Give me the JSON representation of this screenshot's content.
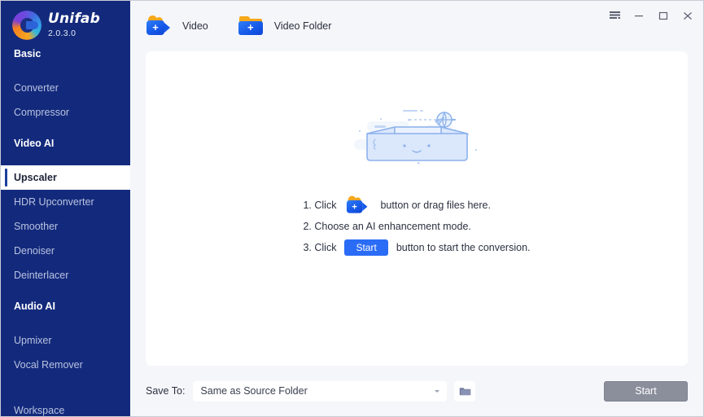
{
  "app": {
    "name": "Unifab",
    "version": "2.0.3.0"
  },
  "window_controls": {
    "menu": "menu-list",
    "minimize": "minimize",
    "maximize": "maximize",
    "close": "close"
  },
  "sidebar": {
    "groups": [
      {
        "label": "Basic"
      },
      {
        "label": "Video AI"
      },
      {
        "label": "Audio AI"
      }
    ],
    "items": [
      {
        "label": "Converter",
        "active": false
      },
      {
        "label": "Compressor",
        "active": false
      },
      {
        "label": "Upscaler",
        "active": true
      },
      {
        "label": "HDR Upconverter",
        "active": false
      },
      {
        "label": "Smoother",
        "active": false
      },
      {
        "label": "Denoiser",
        "active": false
      },
      {
        "label": "Deinterlacer",
        "active": false
      },
      {
        "label": "Upmixer",
        "active": false
      },
      {
        "label": "Vocal Remover",
        "active": false
      }
    ],
    "workspace": "Workspace"
  },
  "toolbar": {
    "video_label": "Video",
    "video_folder_label": "Video Folder"
  },
  "dropzone": {
    "steps": [
      {
        "prefix": "1. Click",
        "badge": "video-icon",
        "suffix": "button or drag files here."
      },
      {
        "prefix": "2. Choose an AI enhancement mode.",
        "badge": "",
        "suffix": ""
      },
      {
        "prefix": "3. Click",
        "badge": "Start",
        "suffix": "button to start the conversion."
      }
    ]
  },
  "bottom": {
    "save_to_label": "Save To:",
    "save_to_value": "Same as Source Folder",
    "browse_icon": "folder-icon",
    "start_label": "Start",
    "start_disabled": true
  },
  "colors": {
    "sidebar_bg": "#132a7c",
    "accent_blue": "#2b6cf6",
    "page_bg": "#f5f6fa",
    "card_bg": "#ffffff",
    "disabled_gray": "#8b8f9c",
    "icon_orange": "#f7a81b",
    "illustration_blue": "#a8c4f0"
  }
}
